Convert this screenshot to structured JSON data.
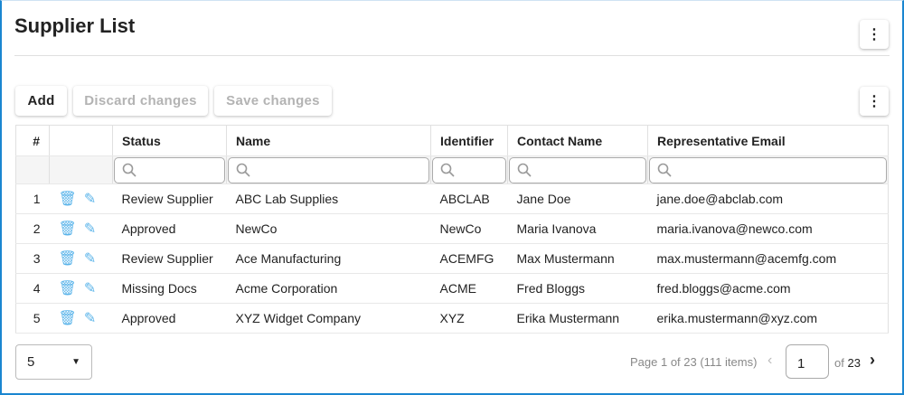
{
  "title": "Supplier List",
  "toolbar": {
    "add": "Add",
    "discard": "Discard changes",
    "save": "Save changes"
  },
  "columns": [
    "#",
    "",
    "Status",
    "Name",
    "Identifier",
    "Contact Name",
    "Representative Email"
  ],
  "rows": [
    [
      "1",
      "Review Supplier",
      "ABC Lab Supplies",
      "ABCLAB",
      "Jane Doe",
      "jane.doe@abclab.com"
    ],
    [
      "2",
      "Approved",
      "NewCo",
      "NewCo",
      "Maria Ivanova",
      "maria.ivanova@newco.com"
    ],
    [
      "3",
      "Review Supplier",
      "Ace Manufacturing",
      "ACEMFG",
      "Max Mustermann",
      "max.mustermann@acemfg.com"
    ],
    [
      "4",
      "Missing Docs",
      "Acme Corporation",
      "ACME",
      "Fred Bloggs",
      "fred.bloggs@acme.com"
    ],
    [
      "5",
      "Approved",
      "XYZ Widget Company",
      "XYZ",
      "Erika Mustermann",
      "erika.mustermann@xyz.com"
    ]
  ],
  "pager": {
    "page_size": "5",
    "info": "Page 1 of 23 (111 items)",
    "page": "1",
    "of_label": "of",
    "total": "23"
  }
}
